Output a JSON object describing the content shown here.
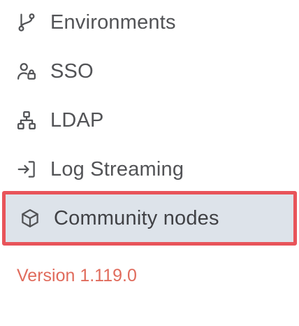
{
  "sidebar": {
    "items": [
      {
        "label": "Environments",
        "icon": "git-branch-icon"
      },
      {
        "label": "SSO",
        "icon": "user-lock-icon"
      },
      {
        "label": "LDAP",
        "icon": "network-icon"
      },
      {
        "label": "Log Streaming",
        "icon": "sign-in-arrow-icon"
      },
      {
        "label": "Community nodes",
        "icon": "cube-icon",
        "active": true
      }
    ],
    "version": "Version 1.119.0"
  },
  "colors": {
    "text": "#525356",
    "active_bg": "#dde3ea",
    "highlight_border": "#e8545a",
    "version_text": "#e06b5c"
  }
}
